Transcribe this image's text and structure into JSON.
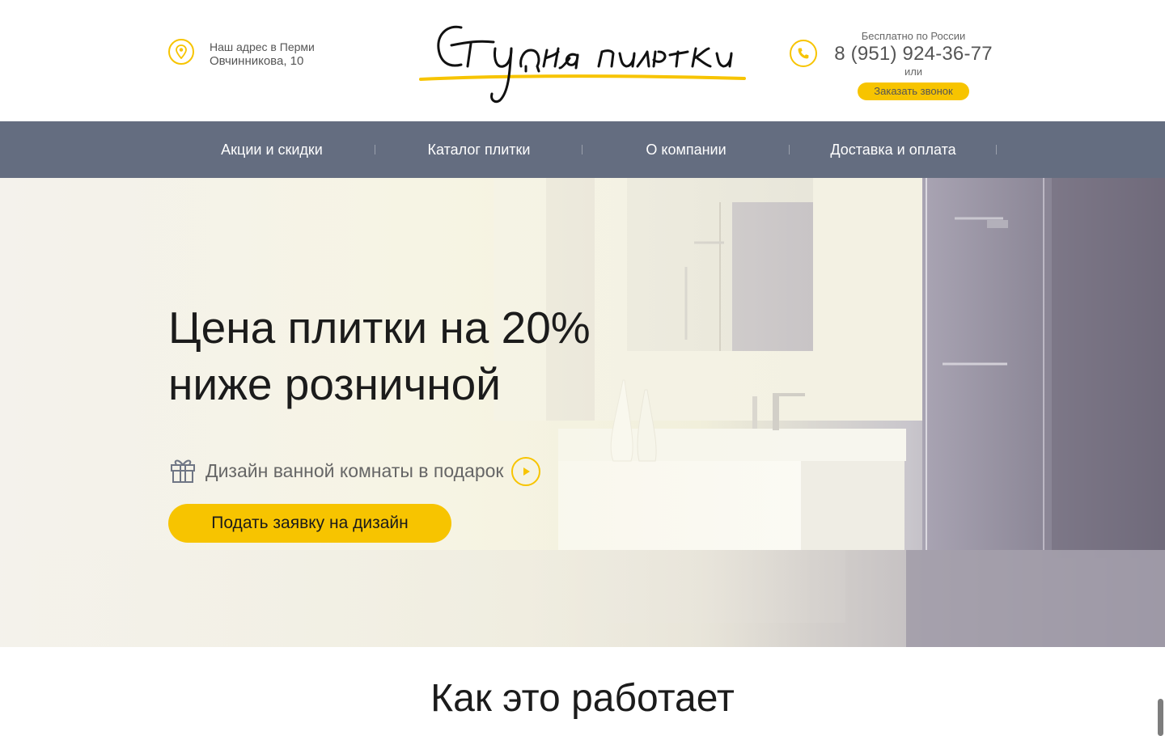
{
  "header": {
    "address_label": "Наш адрес в Перми",
    "address_value": "Овчинникова, 10",
    "logo_text": "Студия плитки",
    "phone_caption": "Бесплатно по России",
    "phone_number": "8 (951) 924-36-77",
    "phone_or": "или",
    "callback_label": "Заказать звонок"
  },
  "nav": {
    "items": [
      {
        "label": "Акции и скидки"
      },
      {
        "label": "Каталог плитки"
      },
      {
        "label": "О компании"
      },
      {
        "label": "Доставка и оплата"
      }
    ]
  },
  "hero": {
    "title_line1": "Цена плитки на 20%",
    "title_line2": "ниже розничной",
    "gift_text": "Дизайн ванной комнаты в подарок",
    "apply_label": "Подать заявку на дизайн"
  },
  "section": {
    "title": "Как это работает"
  },
  "icons": {
    "address": "location-pin-icon",
    "phone": "phone-icon",
    "gift": "gift-icon",
    "play": "play-icon"
  },
  "colors": {
    "accent": "#f7c400",
    "nav_bg": "#646d80",
    "text_dark": "#1b1b1b",
    "text_muted": "#666666"
  }
}
